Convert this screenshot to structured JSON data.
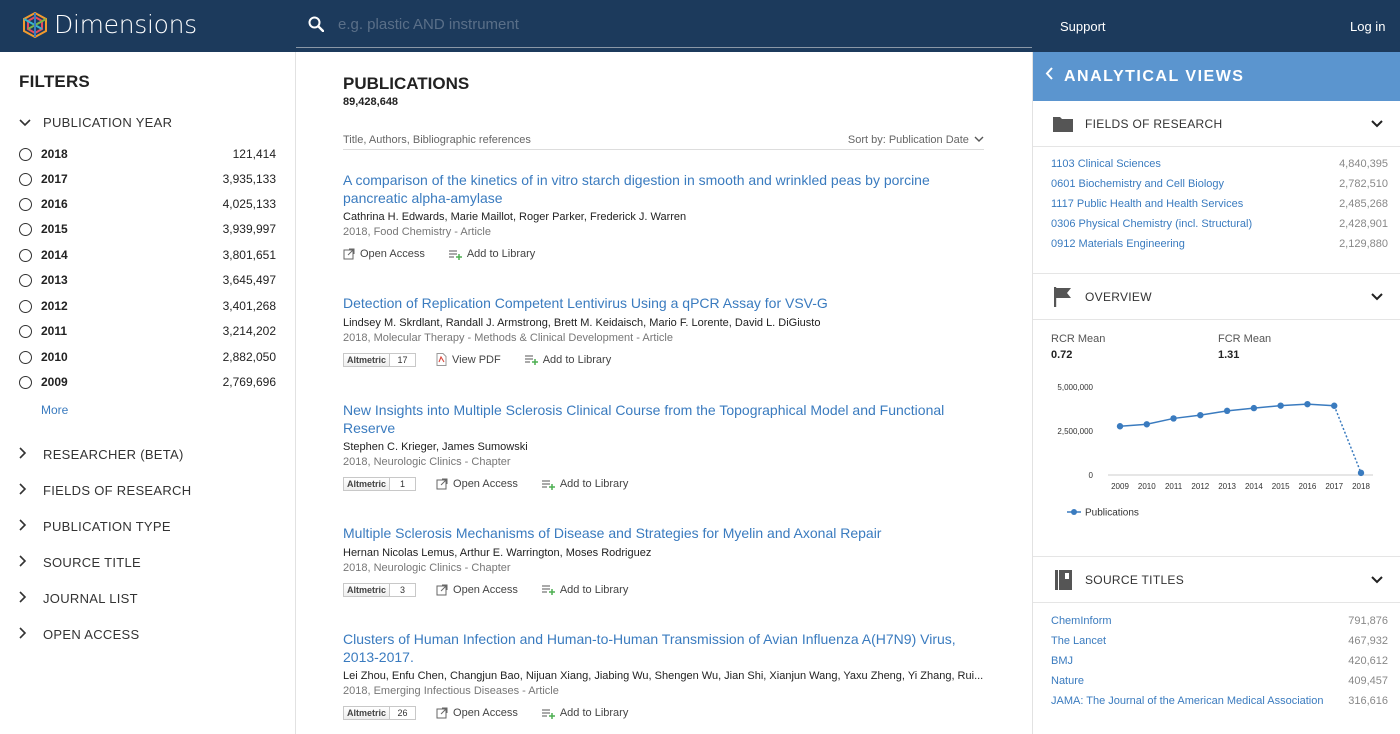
{
  "header": {
    "logo_text": "Dimensions",
    "search_placeholder": "e.g. plastic AND instrument",
    "support_label": "Support",
    "login_label": "Log in"
  },
  "filters": {
    "title": "FILTERS",
    "year_facet": "PUBLICATION YEAR",
    "years": [
      {
        "year": "2018",
        "count": "121,414"
      },
      {
        "year": "2017",
        "count": "3,935,133"
      },
      {
        "year": "2016",
        "count": "4,025,133"
      },
      {
        "year": "2015",
        "count": "3,939,997"
      },
      {
        "year": "2014",
        "count": "3,801,651"
      },
      {
        "year": "2013",
        "count": "3,645,497"
      },
      {
        "year": "2012",
        "count": "3,401,268"
      },
      {
        "year": "2011",
        "count": "3,214,202"
      },
      {
        "year": "2010",
        "count": "2,882,050"
      },
      {
        "year": "2009",
        "count": "2,769,696"
      }
    ],
    "more_label": "More",
    "facets": [
      "RESEARCHER (BETA)",
      "FIELDS OF RESEARCH",
      "PUBLICATION TYPE",
      "SOURCE TITLE",
      "JOURNAL LIST",
      "OPEN ACCESS"
    ]
  },
  "main": {
    "title": "PUBLICATIONS",
    "count": "89,428,648",
    "search_scope": "Title, Authors, Bibliographic references",
    "sort_label": "Sort by: Publication Date",
    "results": [
      {
        "title": "A comparison of the kinetics of in vitro starch digestion in smooth and wrinkled peas by porcine pancreatic alpha-amylase",
        "authors": "Cathrina H. Edwards, Marie Maillot, Roger Parker, Frederick J. Warren",
        "meta": "2018, Food Chemistry - Article",
        "altmetric": "",
        "actions": [
          "Open Access",
          "Add to Library"
        ]
      },
      {
        "title": "Detection of Replication Competent Lentivirus Using a qPCR Assay for VSV-G",
        "authors": "Lindsey M. Skrdlant, Randall J. Armstrong, Brett M. Keidaisch, Mario F. Lorente, David L. DiGiusto",
        "meta": "2018, Molecular Therapy - Methods & Clinical Development - Article",
        "altmetric": "17",
        "actions": [
          "View PDF",
          "Add to Library"
        ]
      },
      {
        "title": "New Insights into Multiple Sclerosis Clinical Course from the Topographical Model and Functional Reserve",
        "authors": "Stephen C. Krieger, James Sumowski",
        "meta": "2018, Neurologic Clinics - Chapter",
        "altmetric": "1",
        "actions": [
          "Open Access",
          "Add to Library"
        ]
      },
      {
        "title": "Multiple Sclerosis Mechanisms of Disease and Strategies for Myelin and Axonal Repair",
        "authors": "Hernan Nicolas Lemus, Arthur E. Warrington, Moses Rodriguez",
        "meta": "2018, Neurologic Clinics - Chapter",
        "altmetric": "3",
        "actions": [
          "Open Access",
          "Add to Library"
        ]
      },
      {
        "title": "Clusters of Human Infection and Human-to-Human Transmission of Avian Influenza A(H7N9) Virus, 2013-2017.",
        "authors": "Lei Zhou, Enfu Chen, Changjun Bao, Nijuan Xiang, Jiabing Wu, Shengen Wu, Jian Shi, Xianjun Wang, Yaxu Zheng, Yi Zhang, Rui...",
        "meta": "2018, Emerging Infectious Diseases - Article",
        "altmetric": "26",
        "actions": [
          "Open Access",
          "Add to Library"
        ]
      }
    ],
    "altmetric_logo": "Altmetric"
  },
  "analytical": {
    "title": "ANALYTICAL VIEWS",
    "fields_title": "FIELDS OF RESEARCH",
    "fields": [
      {
        "name": "1103 Clinical Sciences",
        "count": "4,840,395"
      },
      {
        "name": "0601 Biochemistry and Cell Biology",
        "count": "2,782,510"
      },
      {
        "name": "1117 Public Health and Health Services",
        "count": "2,485,268"
      },
      {
        "name": "0306 Physical Chemistry (incl. Structural)",
        "count": "2,428,901"
      },
      {
        "name": "0912 Materials Engineering",
        "count": "2,129,880"
      }
    ],
    "overview_title": "OVERVIEW",
    "rcr_label": "RCR Mean",
    "rcr_value": "0.72",
    "fcr_label": "FCR Mean",
    "fcr_value": "1.31",
    "sources_title": "SOURCE TITLES",
    "sources": [
      {
        "name": "ChemInform",
        "count": "791,876"
      },
      {
        "name": "The Lancet",
        "count": "467,932"
      },
      {
        "name": "BMJ",
        "count": "420,612"
      },
      {
        "name": "Nature",
        "count": "409,457"
      },
      {
        "name": "JAMA: The Journal of the American Medical Association",
        "count": "316,616"
      }
    ]
  },
  "chart_data": {
    "type": "line",
    "x": [
      "2009",
      "2010",
      "2011",
      "2012",
      "2013",
      "2014",
      "2015",
      "2016",
      "2017",
      "2018"
    ],
    "series": [
      {
        "name": "Publications",
        "values": [
          2769696,
          2882050,
          3214202,
          3401268,
          3645497,
          3801651,
          3939997,
          4025133,
          3935133,
          121414
        ]
      }
    ],
    "y_ticks": [
      "5,000,000",
      "2,500,000",
      "0"
    ],
    "ylim": [
      0,
      5000000
    ],
    "last_segment_dotted": true,
    "color": "#3a7bbf",
    "legend_position": "bottom-left"
  },
  "colors": {
    "topbar": "#1c3a5c",
    "accent_blue": "#5b95cf",
    "link": "#3a7bbf"
  }
}
